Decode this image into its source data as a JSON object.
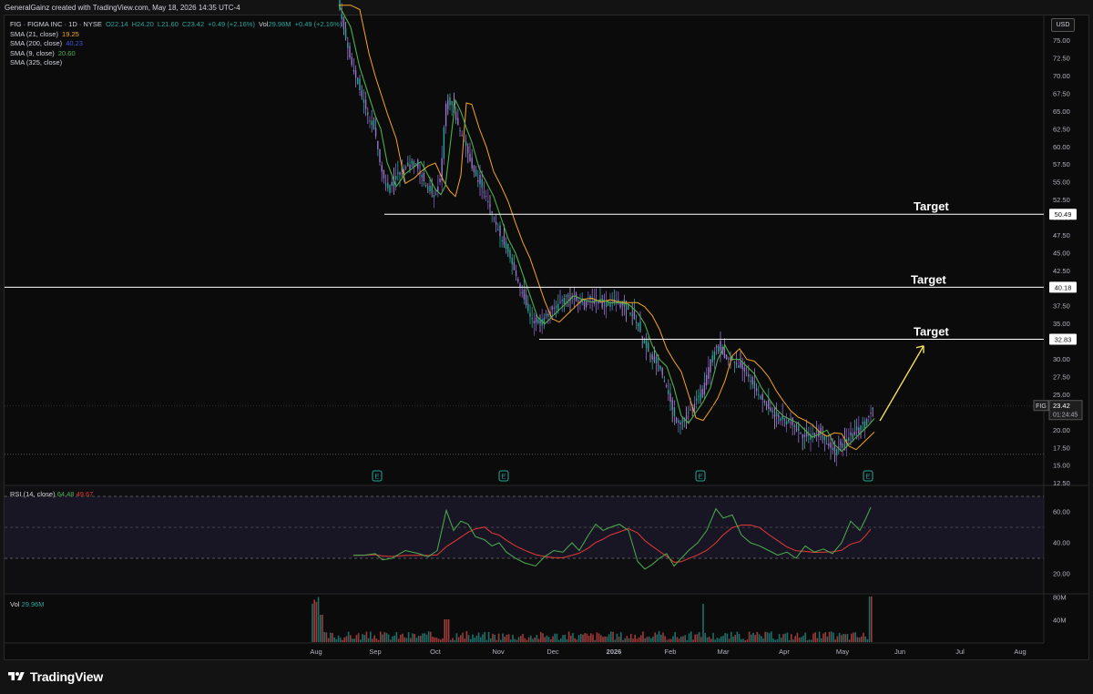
{
  "header": {
    "credit": "GeneralGainz created with TradingView.com, May 18, 2026 14:35 UTC-4"
  },
  "symbol": {
    "title": "FIG · FIGMA INC · 1D · NYSE",
    "open": "O22.14",
    "high": "H24.20",
    "low": "L21.60",
    "close": "C23.42",
    "change": "+0.49 (+2.16%)",
    "vol_label": "Vol",
    "vol_value": "29.96M",
    "vol_change": "+0.49 (+2.16%)"
  },
  "indicators": [
    {
      "label": "SMA (21, close)",
      "value": "19.25",
      "color": "#f5a623"
    },
    {
      "label": "SMA (200, close)",
      "value": "40.23",
      "color": "#3f51d6"
    },
    {
      "label": "SMA (9, close)",
      "value": "20.60",
      "color": "#4caf50"
    },
    {
      "label": "SMA (325, close)",
      "value": "",
      "color": "#d1d4dc"
    }
  ],
  "currency": "USD",
  "price_axis": [
    "75.00",
    "72.50",
    "70.00",
    "67.50",
    "65.00",
    "62.50",
    "60.00",
    "57.50",
    "55.00",
    "52.50",
    "50.00",
    "47.50",
    "45.00",
    "42.50",
    "40.00",
    "37.50",
    "35.00",
    "32.50",
    "30.00",
    "27.50",
    "25.00",
    "22.50",
    "20.00",
    "17.50",
    "15.00",
    "12.50"
  ],
  "time_axis": [
    "Aug",
    "Sep",
    "Oct",
    "Nov",
    "Dec",
    "2026",
    "Feb",
    "Mar",
    "Apr",
    "May",
    "Jun",
    "Jul",
    "Aug"
  ],
  "levels": [
    {
      "price": "50.49",
      "label": "Target"
    },
    {
      "price": "40.18",
      "label": "Target"
    },
    {
      "price": "32.83",
      "label": "Target"
    }
  ],
  "last_price": {
    "ticker": "FIG",
    "price": "23.42",
    "countdown": "01:24:45"
  },
  "earnings_marker": "E",
  "rsi": {
    "label": "RSI (14, close)",
    "value": "64.48",
    "signal": "49.67",
    "axis": [
      "60.00",
      "40.00",
      "20.00"
    ]
  },
  "volume": {
    "label": "Vol",
    "value": "29.96M",
    "axis": [
      "80M",
      "40M"
    ]
  },
  "brand": "TradingView",
  "colors": {
    "up": "#26a69a",
    "down": "#ef5350",
    "sma21": "#f5a623",
    "sma9": "#4caf50",
    "rsi": "#4caf50",
    "rsi_ma": "#e53935",
    "arrow": "#ffee58"
  }
}
